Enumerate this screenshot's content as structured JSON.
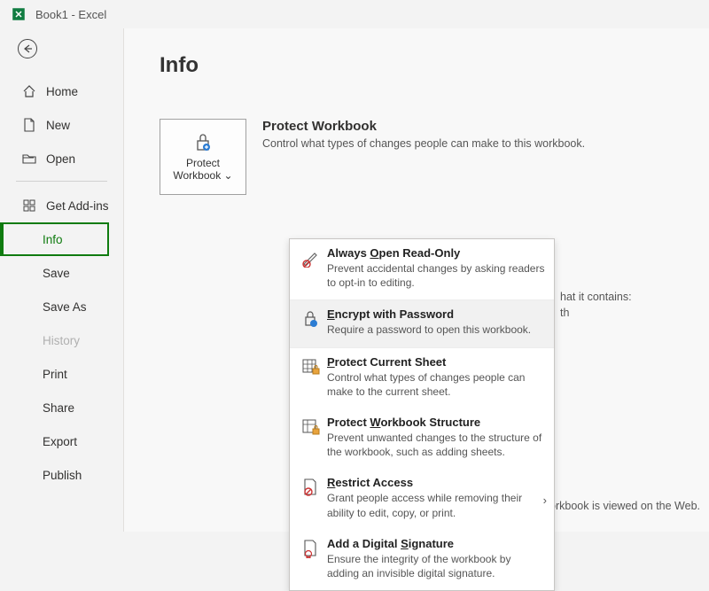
{
  "title": "Book1  -  Excel",
  "page_heading": "Info",
  "nav": {
    "home": "Home",
    "new": "New",
    "open": "Open",
    "addins": "Get Add-ins",
    "info": "Info",
    "save": "Save",
    "saveas": "Save As",
    "history": "History",
    "print": "Print",
    "share": "Share",
    "export": "Export",
    "publish": "Publish"
  },
  "protect_tile": {
    "line1": "Protect",
    "line2": "Workbook",
    "caret": "⌄"
  },
  "protect": {
    "title": "Protect Workbook",
    "desc": "Control what types of changes people can make to this workbook."
  },
  "bg_line1": "hat it contains:",
  "bg_line2": "th",
  "bg_line3": "orkbook is viewed on the Web.",
  "dropdown": {
    "a": {
      "title_pre": "Always ",
      "title_u": "O",
      "title_post": "pen Read-Only",
      "desc": "Prevent accidental changes by asking readers to opt-in to editing."
    },
    "b": {
      "title_u": "E",
      "title_post": "ncrypt with Password",
      "desc": "Require a password to open this workbook."
    },
    "c": {
      "title_u": "P",
      "title_post": "rotect Current Sheet",
      "desc": "Control what types of changes people can make to the current sheet."
    },
    "d": {
      "title_pre": "Protect ",
      "title_u": "W",
      "title_post": "orkbook Structure",
      "desc": "Prevent unwanted changes to the structure of the workbook, such as adding sheets."
    },
    "e": {
      "title_u": "R",
      "title_post": "estrict Access",
      "desc": "Grant people access while removing their ability to edit, copy, or print."
    },
    "f": {
      "title_pre": "Add a Digital ",
      "title_u": "S",
      "title_post": "ignature",
      "desc": "Ensure the integrity of the workbook by adding an invisible digital signature."
    }
  }
}
